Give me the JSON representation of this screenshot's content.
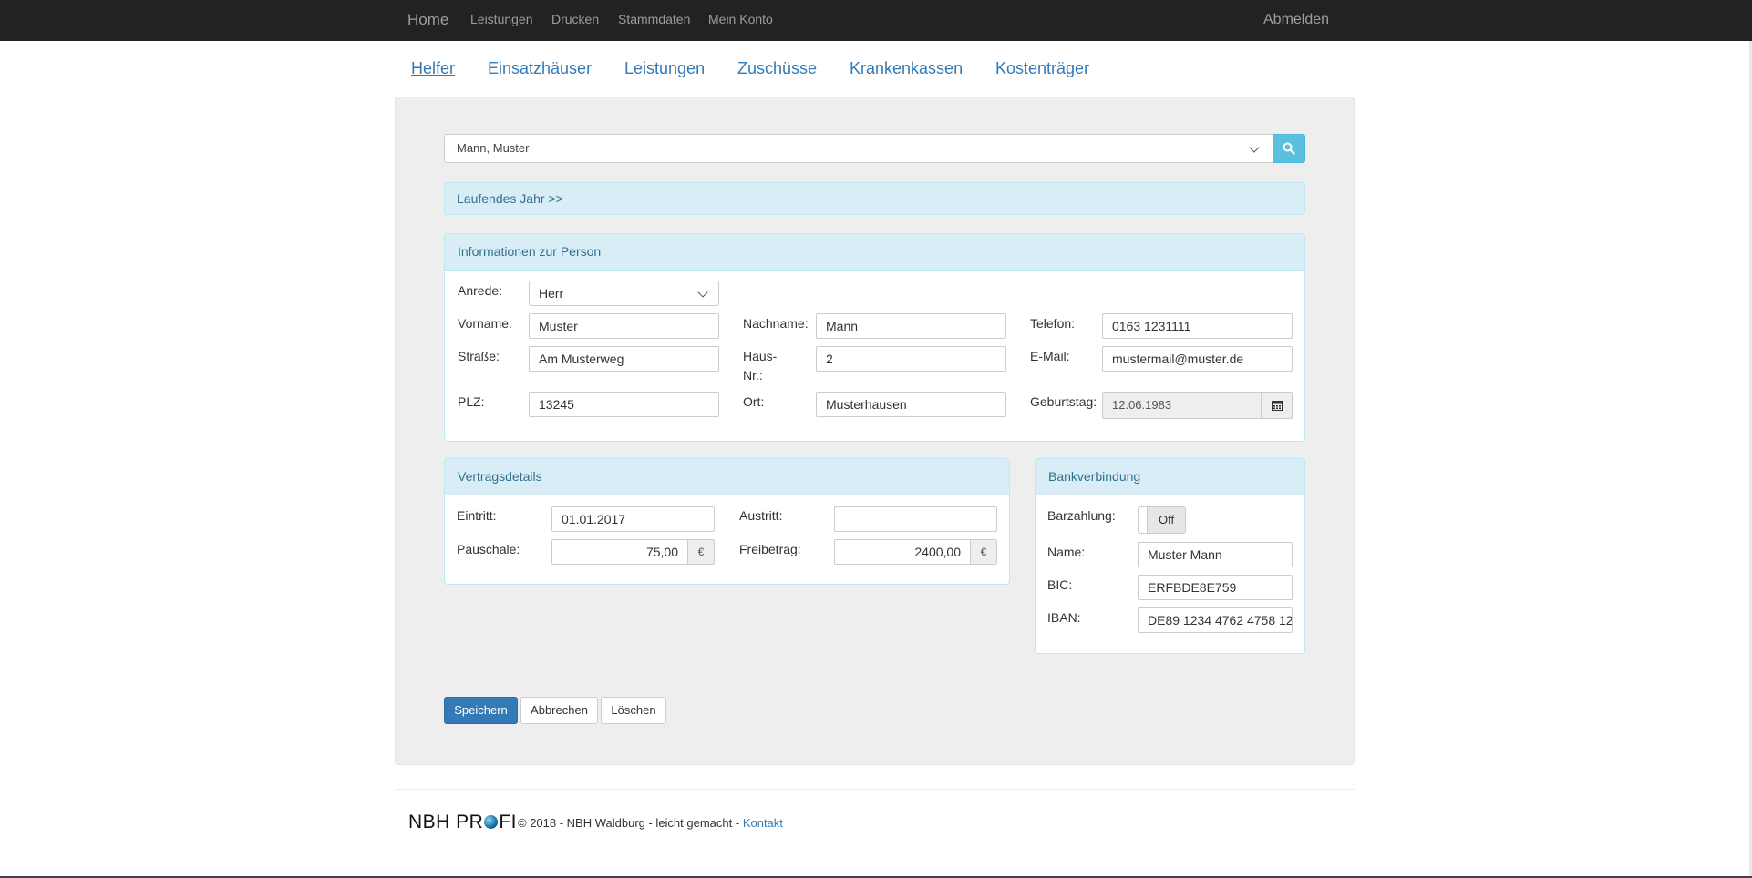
{
  "topnav": {
    "brand": "Home",
    "items": [
      "Leistungen",
      "Drucken",
      "Stammdaten",
      "Mein Konto"
    ],
    "logout": "Abmelden"
  },
  "subnav": {
    "tabs": [
      "Helfer",
      "Einsatzhäuser",
      "Leistungen",
      "Zuschüsse",
      "Krankenkassen",
      "Kostenträger"
    ],
    "active": "Helfer"
  },
  "person_select": {
    "value": "Mann, Muster"
  },
  "year_bar": {
    "label": "Laufendes Jahr >>"
  },
  "person_panel": {
    "title": "Informationen zur Person",
    "anrede_label": "Anrede:",
    "anrede_value": "Herr",
    "vorname_label": "Vorname:",
    "vorname": "Muster",
    "nachname_label": "Nachname:",
    "nachname": "Mann",
    "telefon_label": "Telefon:",
    "telefon": "0163 1231111",
    "strasse_label": "Straße:",
    "strasse": "Am Musterweg",
    "hausnr_label_1": "Haus-",
    "hausnr_label_2": "Nr.:",
    "hausnr": "2",
    "email_label": "E-Mail:",
    "email": "mustermail@muster.de",
    "plz_label": "PLZ:",
    "plz": "13245",
    "ort_label": "Ort:",
    "ort": "Musterhausen",
    "geburtstag_label": "Geburtstag:",
    "geburtstag": "12.06.1983"
  },
  "contract_panel": {
    "title": "Vertragsdetails",
    "eintritt_label": "Eintritt:",
    "eintritt": "01.01.2017",
    "austritt_label": "Austritt:",
    "austritt": "",
    "pauschale_label": "Pauschale:",
    "pauschale": "75,00",
    "freibetrag_label": "Freibetrag:",
    "freibetrag": "2400,00",
    "currency": "€"
  },
  "bank_panel": {
    "title": "Bankverbindung",
    "barzahlung_label": "Barzahlung:",
    "barzahlung_state": "Off",
    "name_label": "Name:",
    "name": "Muster Mann",
    "bic_label": "BIC:",
    "bic": "ERFBDE8E759",
    "iban_label": "IBAN:",
    "iban": "DE89 1234 4762 4758 12"
  },
  "actions": {
    "save": "Speichern",
    "cancel": "Abbrechen",
    "delete": "Löschen"
  },
  "footer": {
    "logo_left": "NBH PR",
    "logo_right": "FI",
    "text": "© 2018 - NBH Waldburg - leicht gemacht - ",
    "link": "Kontakt"
  },
  "colors": {
    "navbar": "#222222",
    "link": "#337ab7",
    "info_bg": "#d9edf7",
    "info_text": "#31708f",
    "primary": "#337ab7",
    "search_btn": "#5bc0de"
  },
  "icons": {
    "search": "search-icon",
    "calendar": "calendar-icon",
    "dropdown": "chevron-down-icon"
  }
}
